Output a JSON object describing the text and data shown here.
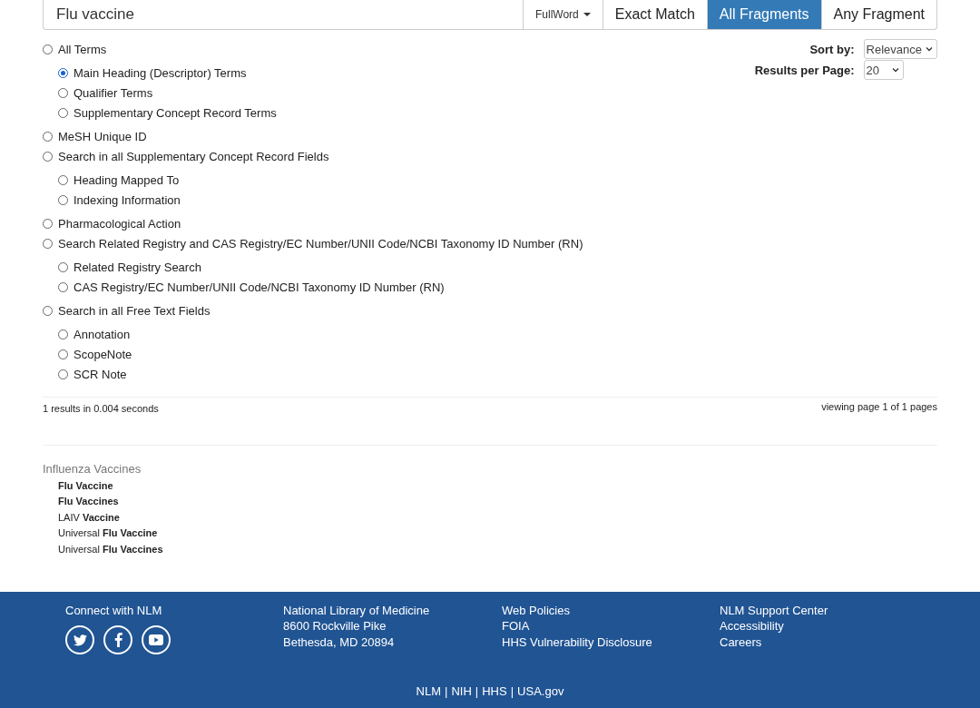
{
  "search": {
    "value": "Flu vaccine",
    "mode": "FullWord",
    "match_buttons": [
      {
        "label": "Exact Match",
        "selected": false
      },
      {
        "label": "All Fragments",
        "selected": true
      },
      {
        "label": "Any Fragment",
        "selected": false
      }
    ]
  },
  "search_options": [
    {
      "label": "All Terms",
      "selected": false,
      "children": [
        {
          "label": "Main Heading (Descriptor) Terms",
          "selected": true
        },
        {
          "label": "Qualifier Terms",
          "selected": false
        },
        {
          "label": "Supplementary Concept Record Terms",
          "selected": false
        }
      ]
    },
    {
      "label": "MeSH Unique ID",
      "selected": false
    },
    {
      "label": "Search in all Supplementary Concept Record Fields",
      "selected": false,
      "children": [
        {
          "label": "Heading Mapped To",
          "selected": false
        },
        {
          "label": "Indexing Information",
          "selected": false
        }
      ]
    },
    {
      "label": "Pharmacological Action",
      "selected": false
    },
    {
      "label": "Search Related Registry and CAS Registry/EC Number/UNII Code/NCBI Taxonomy ID Number (RN)",
      "selected": false,
      "children": [
        {
          "label": "Related Registry Search",
          "selected": false
        },
        {
          "label": "CAS Registry/EC Number/UNII Code/NCBI Taxonomy ID Number (RN)",
          "selected": false
        }
      ]
    },
    {
      "label": "Search in all Free Text Fields",
      "selected": false,
      "children": [
        {
          "label": "Annotation",
          "selected": false
        },
        {
          "label": "ScopeNote",
          "selected": false
        },
        {
          "label": "SCR Note",
          "selected": false
        }
      ]
    }
  ],
  "sort_by": {
    "label": "Sort by:",
    "value": "Relevance"
  },
  "results_per_page": {
    "label": "Results per Page:",
    "value": "20"
  },
  "summary": {
    "count": "1 results in 0.004 seconds",
    "paging": "viewing page 1 of 1 pages"
  },
  "results": [
    {
      "title": "Influenza Vaccines",
      "entries": [
        "**Flu Vaccine**",
        "**Flu Vaccines**",
        "LAIV **Vaccine**",
        "Universal **Flu Vaccine**",
        "Universal **Flu Vaccines**"
      ]
    }
  ],
  "footer": {
    "columns": [
      {
        "title": "Connect with NLM",
        "social": [
          {
            "kind": "twitter"
          },
          {
            "kind": "facebook"
          },
          {
            "kind": "youtube"
          }
        ]
      },
      {
        "lines": [
          "National Library of Medicine",
          "8600 Rockville Pike",
          "Bethesda, MD 20894"
        ]
      },
      {
        "links": [
          "Web Policies",
          "FOIA",
          "HHS Vulnerability Disclosure"
        ]
      },
      {
        "links": [
          "NLM Support Center",
          "Accessibility",
          "Careers"
        ]
      }
    ],
    "bottom_links": [
      "NLM",
      "NIH",
      "HHS",
      "USA.gov"
    ],
    "separator": "|"
  }
}
